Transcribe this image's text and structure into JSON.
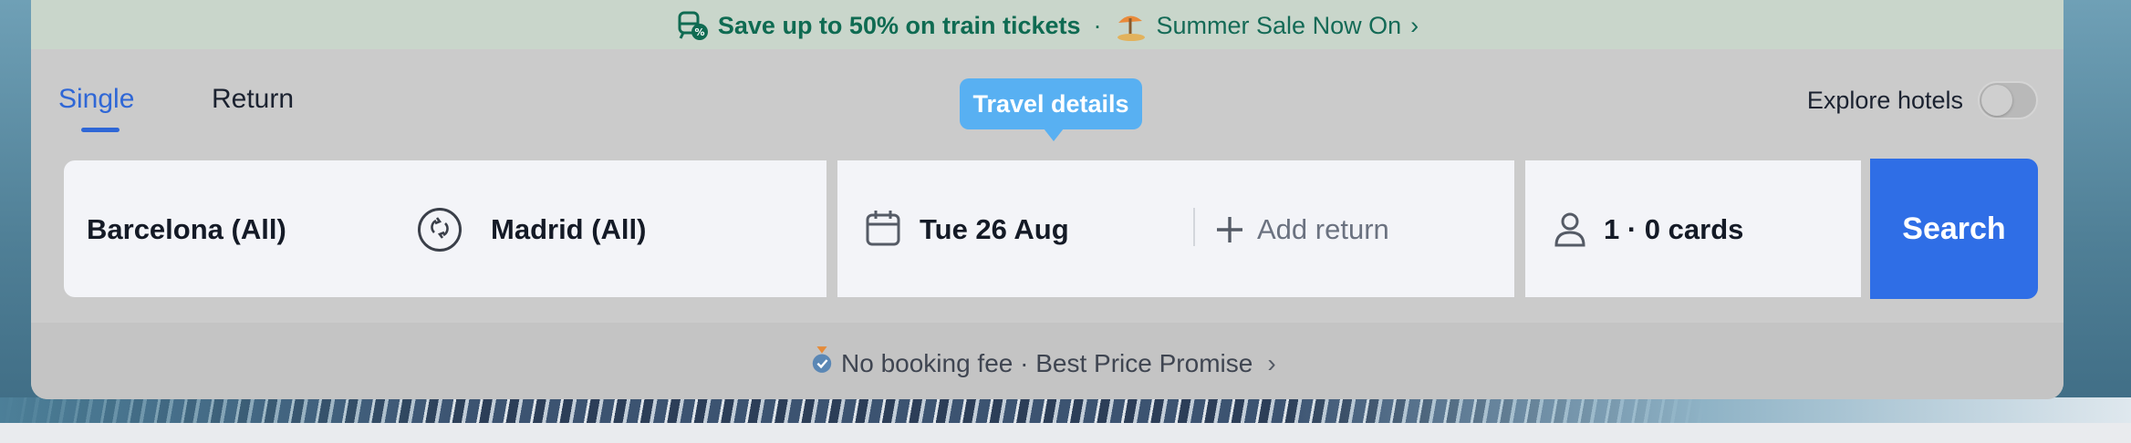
{
  "promo": {
    "headline": "Save up to 50% on train tickets",
    "separator": "·",
    "sale_text": "Summer Sale Now On",
    "chevron": "›",
    "train_icon": "train-discount-icon",
    "beach_icon": "beach-umbrella-icon"
  },
  "tabs": [
    {
      "label": "Single",
      "active": true
    },
    {
      "label": "Return",
      "active": false
    }
  ],
  "tooltip": {
    "text": "Travel details"
  },
  "explore_hotels": {
    "label": "Explore hotels",
    "enabled": false
  },
  "search": {
    "origin": "Barcelona (All)",
    "destination": "Madrid (All)",
    "date": "Tue 26 Aug",
    "add_return": "Add return",
    "passengers": "1 · 0 cards",
    "button_label": "Search"
  },
  "footer": {
    "promise_text": "No booking fee · Best Price Promise",
    "chevron": "›",
    "badge_icon": "medal-check-icon"
  },
  "colors": {
    "accent": "#2f6ee6",
    "tab_active": "#2f67d6",
    "tooltip": "#58b0f2",
    "promo_text": "#0f6b52"
  }
}
